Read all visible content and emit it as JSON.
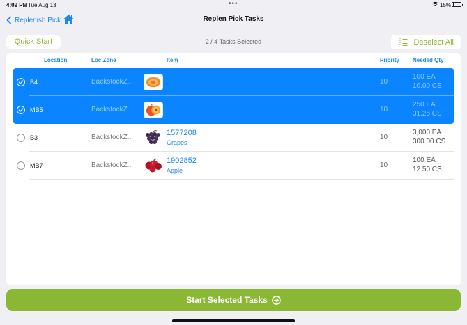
{
  "status_bar": {
    "time": "4:09 PM",
    "date": "Tue Aug 13",
    "dots": "•••",
    "battery_pct": "15%",
    "battery_level": 0.15
  },
  "nav": {
    "back_label": "Replenish Pick",
    "title": "Replen Pick Tasks"
  },
  "toolbar": {
    "quick_start": "Quick Start",
    "selected_count": "2 / 4 Tasks Selected",
    "deselect_all": "Deselect All"
  },
  "table": {
    "columns": {
      "location": "Location",
      "loc_zone": "Loc Zone",
      "item": "Item",
      "priority": "Priority",
      "needed_qty": "Needed Qty"
    },
    "rows": [
      {
        "selected": true,
        "location": "B4",
        "loc_zone": "BackstockZ...",
        "item_number": "",
        "item_name": "",
        "thumb": "cantaloupe-icon",
        "priority": "10",
        "qty_ea": "100 EA",
        "qty_cs": "10.00 CS"
      },
      {
        "selected": true,
        "location": "MB5",
        "loc_zone": "BackstockZ...",
        "item_number": "",
        "item_name": "",
        "thumb": "peach-icon",
        "priority": "10",
        "qty_ea": "250 EA",
        "qty_cs": "31.25 CS"
      },
      {
        "selected": false,
        "location": "B3",
        "loc_zone": "BackstockZ...",
        "item_number": "1577208",
        "item_name": "Grapes",
        "thumb": "grapes-icon",
        "priority": "10",
        "qty_ea": "3,000 EA",
        "qty_cs": "300.00 CS"
      },
      {
        "selected": false,
        "location": "MB7",
        "loc_zone": "BackstockZ...",
        "item_number": "1902852",
        "item_name": "Apple",
        "thumb": "apple-icon",
        "priority": "10",
        "qty_ea": "100 EA",
        "qty_cs": "12.50 CS"
      }
    ]
  },
  "footer": {
    "start_label": "Start Selected Tasks"
  },
  "colors": {
    "accent_blue": "#1e88e5",
    "selection_blue": "#0a84ff",
    "action_green": "#8ab734",
    "background": "#efeff4"
  }
}
